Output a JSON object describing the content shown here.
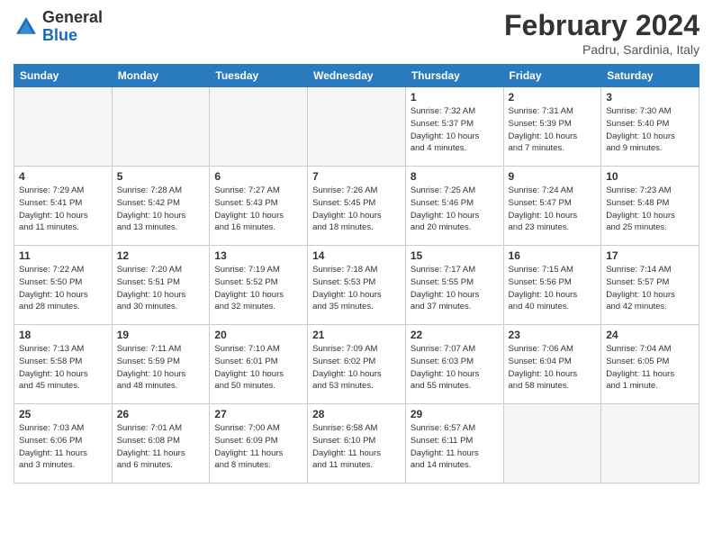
{
  "header": {
    "logo_general": "General",
    "logo_blue": "Blue",
    "month_title": "February 2024",
    "location": "Padru, Sardinia, Italy"
  },
  "days_of_week": [
    "Sunday",
    "Monday",
    "Tuesday",
    "Wednesday",
    "Thursday",
    "Friday",
    "Saturday"
  ],
  "weeks": [
    [
      {
        "day": "",
        "info": ""
      },
      {
        "day": "",
        "info": ""
      },
      {
        "day": "",
        "info": ""
      },
      {
        "day": "",
        "info": ""
      },
      {
        "day": "1",
        "info": "Sunrise: 7:32 AM\nSunset: 5:37 PM\nDaylight: 10 hours\nand 4 minutes."
      },
      {
        "day": "2",
        "info": "Sunrise: 7:31 AM\nSunset: 5:39 PM\nDaylight: 10 hours\nand 7 minutes."
      },
      {
        "day": "3",
        "info": "Sunrise: 7:30 AM\nSunset: 5:40 PM\nDaylight: 10 hours\nand 9 minutes."
      }
    ],
    [
      {
        "day": "4",
        "info": "Sunrise: 7:29 AM\nSunset: 5:41 PM\nDaylight: 10 hours\nand 11 minutes."
      },
      {
        "day": "5",
        "info": "Sunrise: 7:28 AM\nSunset: 5:42 PM\nDaylight: 10 hours\nand 13 minutes."
      },
      {
        "day": "6",
        "info": "Sunrise: 7:27 AM\nSunset: 5:43 PM\nDaylight: 10 hours\nand 16 minutes."
      },
      {
        "day": "7",
        "info": "Sunrise: 7:26 AM\nSunset: 5:45 PM\nDaylight: 10 hours\nand 18 minutes."
      },
      {
        "day": "8",
        "info": "Sunrise: 7:25 AM\nSunset: 5:46 PM\nDaylight: 10 hours\nand 20 minutes."
      },
      {
        "day": "9",
        "info": "Sunrise: 7:24 AM\nSunset: 5:47 PM\nDaylight: 10 hours\nand 23 minutes."
      },
      {
        "day": "10",
        "info": "Sunrise: 7:23 AM\nSunset: 5:48 PM\nDaylight: 10 hours\nand 25 minutes."
      }
    ],
    [
      {
        "day": "11",
        "info": "Sunrise: 7:22 AM\nSunset: 5:50 PM\nDaylight: 10 hours\nand 28 minutes."
      },
      {
        "day": "12",
        "info": "Sunrise: 7:20 AM\nSunset: 5:51 PM\nDaylight: 10 hours\nand 30 minutes."
      },
      {
        "day": "13",
        "info": "Sunrise: 7:19 AM\nSunset: 5:52 PM\nDaylight: 10 hours\nand 32 minutes."
      },
      {
        "day": "14",
        "info": "Sunrise: 7:18 AM\nSunset: 5:53 PM\nDaylight: 10 hours\nand 35 minutes."
      },
      {
        "day": "15",
        "info": "Sunrise: 7:17 AM\nSunset: 5:55 PM\nDaylight: 10 hours\nand 37 minutes."
      },
      {
        "day": "16",
        "info": "Sunrise: 7:15 AM\nSunset: 5:56 PM\nDaylight: 10 hours\nand 40 minutes."
      },
      {
        "day": "17",
        "info": "Sunrise: 7:14 AM\nSunset: 5:57 PM\nDaylight: 10 hours\nand 42 minutes."
      }
    ],
    [
      {
        "day": "18",
        "info": "Sunrise: 7:13 AM\nSunset: 5:58 PM\nDaylight: 10 hours\nand 45 minutes."
      },
      {
        "day": "19",
        "info": "Sunrise: 7:11 AM\nSunset: 5:59 PM\nDaylight: 10 hours\nand 48 minutes."
      },
      {
        "day": "20",
        "info": "Sunrise: 7:10 AM\nSunset: 6:01 PM\nDaylight: 10 hours\nand 50 minutes."
      },
      {
        "day": "21",
        "info": "Sunrise: 7:09 AM\nSunset: 6:02 PM\nDaylight: 10 hours\nand 53 minutes."
      },
      {
        "day": "22",
        "info": "Sunrise: 7:07 AM\nSunset: 6:03 PM\nDaylight: 10 hours\nand 55 minutes."
      },
      {
        "day": "23",
        "info": "Sunrise: 7:06 AM\nSunset: 6:04 PM\nDaylight: 10 hours\nand 58 minutes."
      },
      {
        "day": "24",
        "info": "Sunrise: 7:04 AM\nSunset: 6:05 PM\nDaylight: 11 hours\nand 1 minute."
      }
    ],
    [
      {
        "day": "25",
        "info": "Sunrise: 7:03 AM\nSunset: 6:06 PM\nDaylight: 11 hours\nand 3 minutes."
      },
      {
        "day": "26",
        "info": "Sunrise: 7:01 AM\nSunset: 6:08 PM\nDaylight: 11 hours\nand 6 minutes."
      },
      {
        "day": "27",
        "info": "Sunrise: 7:00 AM\nSunset: 6:09 PM\nDaylight: 11 hours\nand 8 minutes."
      },
      {
        "day": "28",
        "info": "Sunrise: 6:58 AM\nSunset: 6:10 PM\nDaylight: 11 hours\nand 11 minutes."
      },
      {
        "day": "29",
        "info": "Sunrise: 6:57 AM\nSunset: 6:11 PM\nDaylight: 11 hours\nand 14 minutes."
      },
      {
        "day": "",
        "info": ""
      },
      {
        "day": "",
        "info": ""
      }
    ]
  ]
}
